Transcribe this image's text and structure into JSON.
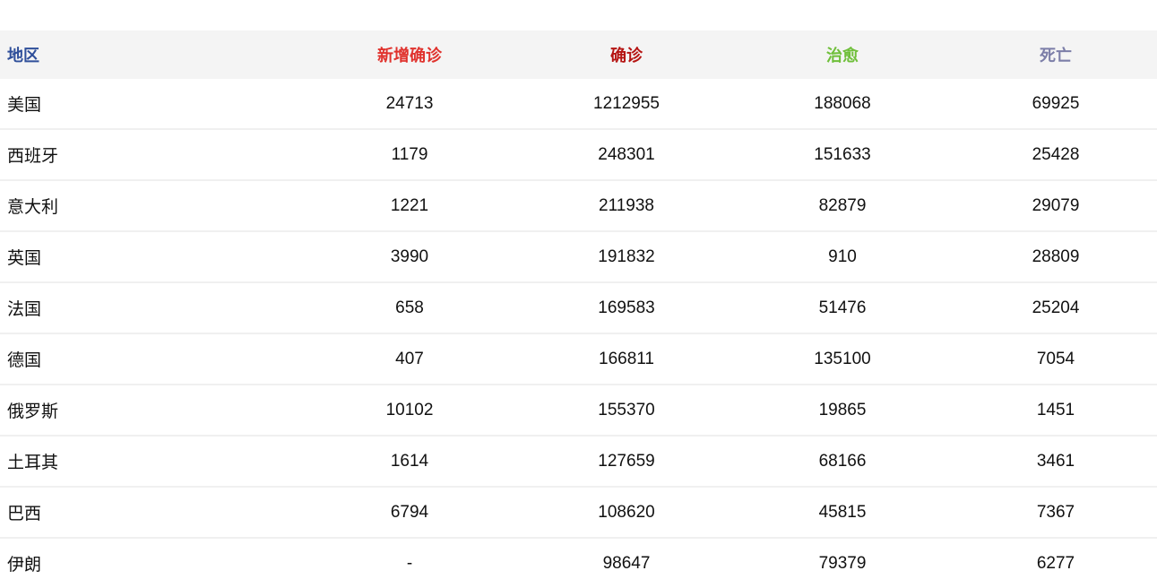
{
  "table": {
    "headers": [
      {
        "label": "地区",
        "color": "#2f4f9a"
      },
      {
        "label": "新增确诊",
        "color": "#e0322d"
      },
      {
        "label": "确诊",
        "color": "#b51412"
      },
      {
        "label": "治愈",
        "color": "#6fbf3a"
      },
      {
        "label": "死亡",
        "color": "#7c7ea8"
      }
    ],
    "rows": [
      {
        "region": "美国",
        "new_confirmed": "24713",
        "confirmed": "1212955",
        "cured": "188068",
        "deaths": "69925"
      },
      {
        "region": "西班牙",
        "new_confirmed": "1179",
        "confirmed": "248301",
        "cured": "151633",
        "deaths": "25428"
      },
      {
        "region": "意大利",
        "new_confirmed": "1221",
        "confirmed": "211938",
        "cured": "82879",
        "deaths": "29079"
      },
      {
        "region": "英国",
        "new_confirmed": "3990",
        "confirmed": "191832",
        "cured": "910",
        "deaths": "28809"
      },
      {
        "region": "法国",
        "new_confirmed": "658",
        "confirmed": "169583",
        "cured": "51476",
        "deaths": "25204"
      },
      {
        "region": "德国",
        "new_confirmed": "407",
        "confirmed": "166811",
        "cured": "135100",
        "deaths": "7054"
      },
      {
        "region": "俄罗斯",
        "new_confirmed": "10102",
        "confirmed": "155370",
        "cured": "19865",
        "deaths": "1451"
      },
      {
        "region": "土耳其",
        "new_confirmed": "1614",
        "confirmed": "127659",
        "cured": "68166",
        "deaths": "3461"
      },
      {
        "region": "巴西",
        "new_confirmed": "6794",
        "confirmed": "108620",
        "cured": "45815",
        "deaths": "7367"
      },
      {
        "region": "伊朗",
        "new_confirmed": "-",
        "confirmed": "98647",
        "cured": "79379",
        "deaths": "6277"
      }
    ]
  }
}
